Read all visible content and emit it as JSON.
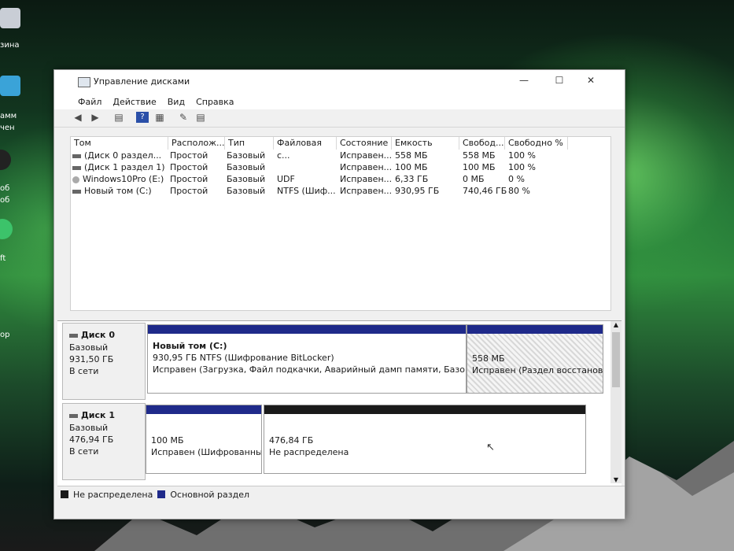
{
  "desktop": {
    "icons": [
      {
        "label": "зина",
        "icon": "recycle-bin-icon"
      },
      {
        "label": "амм\nчен",
        "icon": "program-icon"
      },
      {
        "label": "об\nоб",
        "icon": "app-icon"
      },
      {
        "label": "ft",
        "icon": "app-icon"
      },
      {
        "label": "ор",
        "icon": "app-icon"
      }
    ]
  },
  "window": {
    "title": "Управление дисками",
    "controls": {
      "minimize": "—",
      "maximize": "☐",
      "close": "✕"
    },
    "menu": [
      "Файл",
      "Действие",
      "Вид",
      "Справка"
    ],
    "toolbar": [
      "back-icon",
      "forward-icon",
      "properties-icon",
      "help-icon",
      "view-icon",
      "connect-icon",
      "settings-icon"
    ]
  },
  "volumes": {
    "columns": [
      "Том",
      "Располож...",
      "Тип",
      "Файловая с...",
      "Состояние",
      "Емкость",
      "Свобод...",
      "Свободно %"
    ],
    "rows": [
      {
        "name": "(Диск 0 раздел...",
        "layout": "Простой",
        "type": "Базовый",
        "fs": "",
        "status": "Исправен...",
        "capacity": "558 МБ",
        "free": "558 МБ",
        "free_pct": "100 %",
        "icon": "volume-icon"
      },
      {
        "name": "(Диск 1 раздел 1)",
        "layout": "Простой",
        "type": "Базовый",
        "fs": "",
        "status": "Исправен...",
        "capacity": "100 МБ",
        "free": "100 МБ",
        "free_pct": "100 %",
        "icon": "volume-icon"
      },
      {
        "name": "Windows10Pro (E:)",
        "layout": "Простой",
        "type": "Базовый",
        "fs": "UDF",
        "status": "Исправен...",
        "capacity": "6,33 ГБ",
        "free": "0 МБ",
        "free_pct": "0 %",
        "icon": "cd-drive-icon"
      },
      {
        "name": "Новый том (C:)",
        "layout": "Простой",
        "type": "Базовый",
        "fs": "NTFS (Шиф...",
        "status": "Исправен...",
        "capacity": "930,95 ГБ",
        "free": "740,46 ГБ",
        "free_pct": "80 %",
        "icon": "volume-icon"
      }
    ]
  },
  "disks": [
    {
      "name": "Диск 0",
      "type": "Базовый",
      "size": "931,50 ГБ",
      "state": "В сети",
      "partitions": [
        {
          "title": "Новый том  (C:)",
          "line1": "930,95 ГБ NTFS (Шифрование BitLocker)",
          "line2": "Исправен (Загрузка, Файл подкачки, Аварийный дамп памяти, Базовый р",
          "color": "#1f2a8a"
        },
        {
          "title": "",
          "line1": "558 МБ",
          "line2": "Исправен (Раздел восстановлен",
          "color": "#1f2a8a"
        }
      ]
    },
    {
      "name": "Диск 1",
      "type": "Базовый",
      "size": "476,94 ГБ",
      "state": "В сети",
      "partitions": [
        {
          "title": "",
          "line1": "100 МБ",
          "line2": "Исправен (Шифрованны",
          "color": "#1f2a8a"
        },
        {
          "title": "",
          "line1": "476,84 ГБ",
          "line2": "Не распределена",
          "color": "#1a1a1a"
        }
      ]
    }
  ],
  "legend": [
    {
      "label": "Не распределена",
      "color": "#1a1a1a"
    },
    {
      "label": "Основной раздел",
      "color": "#1f2a8a"
    }
  ]
}
